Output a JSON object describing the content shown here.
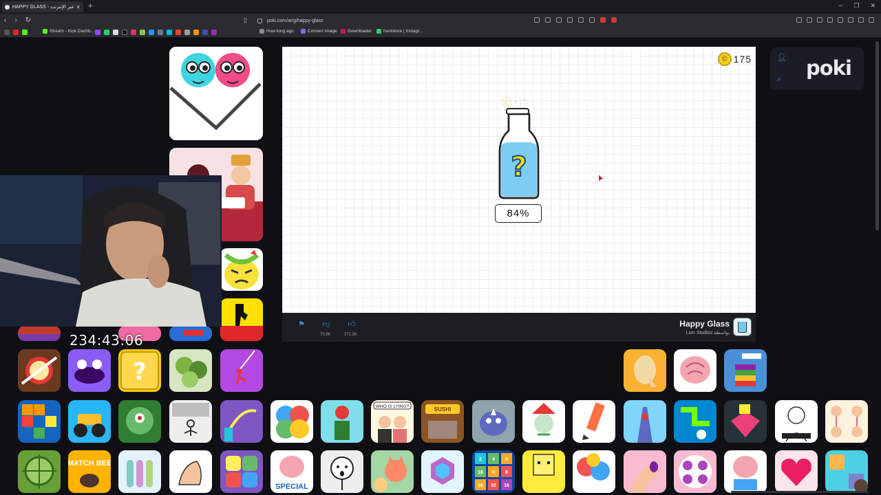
{
  "browser": {
    "tab_title": "HAPPY GLASS - العب عبر الإنترنت",
    "url": "poki.com/ar/g/happy-glass",
    "bookmarks": [
      "Stream - Kick Dashb...",
      "How long ago",
      "Convert Image",
      "Downloader",
      "huntstore | Instagr..."
    ]
  },
  "game": {
    "coins": "175",
    "coin_reward": "+25",
    "bottle_symbol": "?",
    "fill_percent": "84%",
    "fill_value": 0.84,
    "coin_icon": "coin-icon",
    "title": "Happy Glass",
    "studio": "Lion Studios بواسطة",
    "dislikes": "70.8K",
    "likes": "372.5K"
  },
  "poki": {
    "logo": "poki"
  },
  "overlay": {
    "timer": "234:43:06"
  },
  "thumbs": {
    "who_is_lying": "WHO IS LYING?",
    "match_bee": "MATCH BEE",
    "special": "SPECIAL",
    "sushi": "SUSHI",
    "numbers": [
      "2",
      "4",
      "8",
      "16",
      "4",
      "8",
      "16",
      "32",
      "16"
    ]
  }
}
